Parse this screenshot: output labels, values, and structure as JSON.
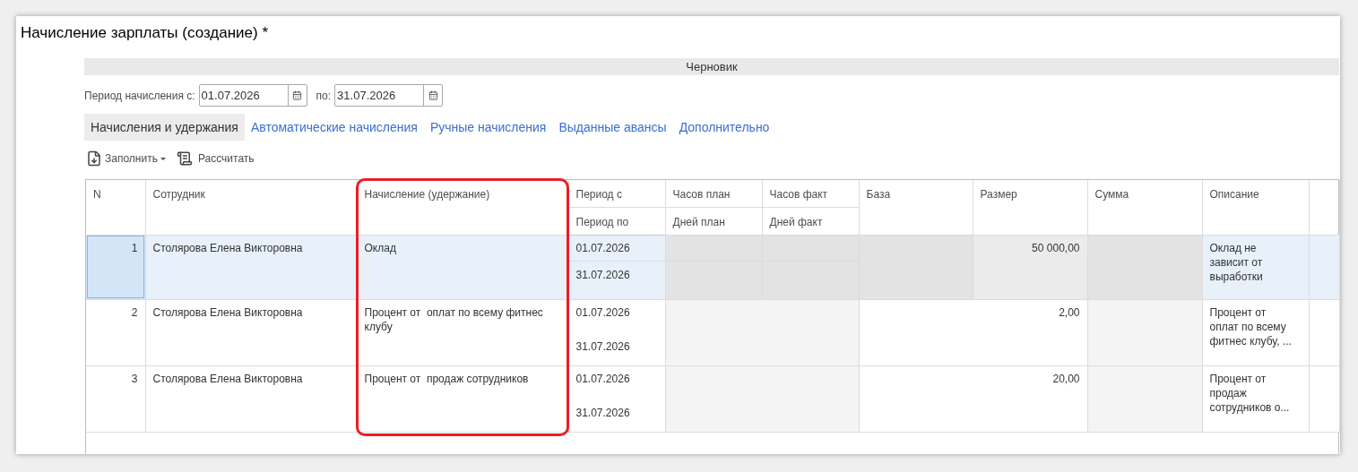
{
  "window": {
    "title": "Начисление зарплаты (создание) *"
  },
  "status": "Черновик",
  "period": {
    "from_label": "Период начисления с:",
    "from_value": "01.07.2026",
    "to_label": "по:",
    "to_value": "31.07.2026"
  },
  "tabs": [
    {
      "label": "Начисления и удержания",
      "selected": true
    },
    {
      "label": "Автоматические начисления",
      "selected": false
    },
    {
      "label": "Ручные начисления",
      "selected": false
    },
    {
      "label": "Выданные авансы",
      "selected": false
    },
    {
      "label": "Дополнительно",
      "selected": false
    }
  ],
  "toolbar": [
    {
      "kind": "menu",
      "label": "Заполнить"
    },
    {
      "kind": "action",
      "label": "Рассчитать"
    }
  ],
  "table": {
    "columns": {
      "n": "N",
      "employee": "Сотрудник",
      "accrual": "Начисление (удержание)",
      "period_from": "Период с",
      "period_to": "Период по",
      "hours_plan": "Часов план",
      "days_plan": "Дней план",
      "hours_fact": "Часов факт",
      "days_fact": "Дней факт",
      "base": "База",
      "size": "Размер",
      "sum": "Сумма",
      "description": "Описание"
    },
    "rows": [
      {
        "kind": "fixed",
        "selected": true,
        "n": "1",
        "employee": "Столярова Елена Викторовна",
        "accrual": "Оклад",
        "period_from": "01.07.2026",
        "period_to": "31.07.2026",
        "size": "50 000,00",
        "description": "Оклад не зависит от выработки"
      },
      {
        "kind": "percent",
        "selected": false,
        "n": "2",
        "employee": "Столярова Елена Викторовна",
        "accrual": "Процент от  оплат по всему фитнес клубу",
        "period_from": "01.07.2026",
        "period_to": "31.07.2026",
        "size": "2,00",
        "description": "Процент от оплат по всему фитнес клубу, ..."
      },
      {
        "kind": "percent",
        "selected": false,
        "n": "3",
        "employee": "Столярова Елена Викторовна",
        "accrual": "Процент от  продаж сотрудников",
        "period_from": "01.07.2026",
        "period_to": "31.07.2026",
        "size": "20,00",
        "description": "Процент от продаж сотрудников о..."
      }
    ]
  },
  "highlight_frame": true
}
